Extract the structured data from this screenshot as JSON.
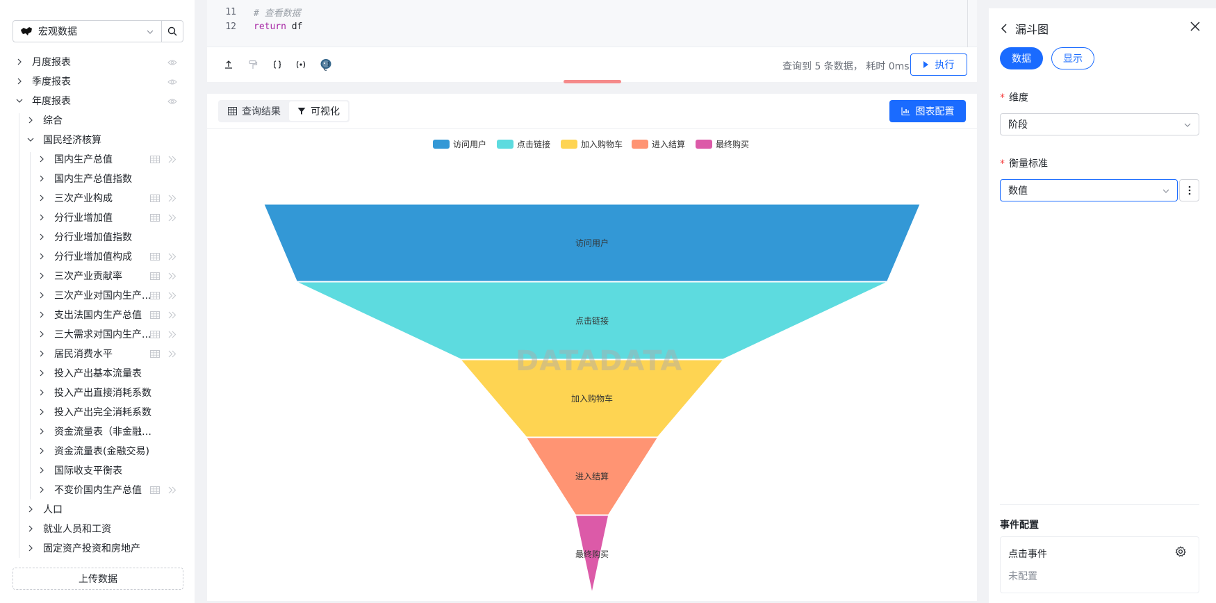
{
  "datasource": {
    "name": "宏观数据"
  },
  "tree": [
    {
      "label": "月度报表",
      "level": 0,
      "expanded": false,
      "icons": "eye"
    },
    {
      "label": "季度报表",
      "level": 0,
      "expanded": false,
      "icons": "eye"
    },
    {
      "label": "年度报表",
      "level": 0,
      "expanded": true,
      "icons": "eye"
    },
    {
      "label": "综合",
      "level": 1,
      "expanded": false,
      "icons": ""
    },
    {
      "label": "国民经济核算",
      "level": 1,
      "expanded": true,
      "icons": ""
    },
    {
      "label": "国内生产总值",
      "level": 2,
      "expanded": false,
      "icons": "table"
    },
    {
      "label": "国内生产总值指数",
      "level": 2,
      "expanded": false,
      "icons": ""
    },
    {
      "label": "三次产业构成",
      "level": 2,
      "expanded": false,
      "icons": "table"
    },
    {
      "label": "分行业增加值",
      "level": 2,
      "expanded": false,
      "icons": "table"
    },
    {
      "label": "分行业增加值指数",
      "level": 2,
      "expanded": false,
      "icons": ""
    },
    {
      "label": "分行业增加值构成",
      "level": 2,
      "expanded": false,
      "icons": "table"
    },
    {
      "label": "三次产业贡献率",
      "level": 2,
      "expanded": false,
      "icons": "table"
    },
    {
      "label": "三次产业对国内生产...",
      "level": 2,
      "expanded": false,
      "icons": "table"
    },
    {
      "label": "支出法国内生产总值",
      "level": 2,
      "expanded": false,
      "icons": "table"
    },
    {
      "label": "三大需求对国内生产...",
      "level": 2,
      "expanded": false,
      "icons": "table"
    },
    {
      "label": "居民消费水平",
      "level": 2,
      "expanded": false,
      "icons": "table"
    },
    {
      "label": "投入产出基本流量表",
      "level": 2,
      "expanded": false,
      "icons": ""
    },
    {
      "label": "投入产出直接消耗系数",
      "level": 2,
      "expanded": false,
      "icons": ""
    },
    {
      "label": "投入产出完全消耗系数",
      "level": 2,
      "expanded": false,
      "icons": ""
    },
    {
      "label": "资金流量表（非金融交易）",
      "level": 2,
      "expanded": false,
      "icons": ""
    },
    {
      "label": "资金流量表(金融交易)",
      "level": 2,
      "expanded": false,
      "icons": ""
    },
    {
      "label": "国际收支平衡表",
      "level": 2,
      "expanded": false,
      "icons": ""
    },
    {
      "label": "不变价国内生产总值",
      "level": 2,
      "expanded": false,
      "icons": "table"
    },
    {
      "label": "人口",
      "level": 1,
      "expanded": false,
      "icons": ""
    },
    {
      "label": "就业人员和工资",
      "level": 1,
      "expanded": false,
      "icons": ""
    },
    {
      "label": "固定资产投资和房地产",
      "level": 1,
      "expanded": false,
      "icons": ""
    }
  ],
  "upload_label": "上传数据",
  "editor": {
    "lines": [
      {
        "num": "11",
        "text": "# 查看数据",
        "kind": "comment"
      },
      {
        "num": "12",
        "keyword": "return",
        "text": " df",
        "kind": "code"
      }
    ],
    "query_info": "查询到 5 条数据，  耗时 0ms",
    "run_label": "执行"
  },
  "result": {
    "tab_table": "查询结果",
    "tab_chart": "可视化",
    "chart_config_label": "图表配置",
    "watermark": "DATADATA"
  },
  "chart_data": {
    "type": "funnel",
    "categories": [
      "访问用户",
      "点击链接",
      "加入购物车",
      "进入结算",
      "最终购买"
    ],
    "values": [
      100,
      90,
      40,
      20,
      5
    ],
    "colors": [
      "#3398d6",
      "#5ddbdf",
      "#fed452",
      "#ff9473",
      "#dc5aa8"
    ],
    "legend_position": "top-center"
  },
  "panel": {
    "title": "漏斗图",
    "seg_data": "数据",
    "seg_display": "显示",
    "dimension_label": "维度",
    "dimension_value": "阶段",
    "measure_label": "衡量标准",
    "measure_value": "数值",
    "event_title": "事件配置",
    "event_name": "点击事件",
    "event_status": "未配置"
  }
}
